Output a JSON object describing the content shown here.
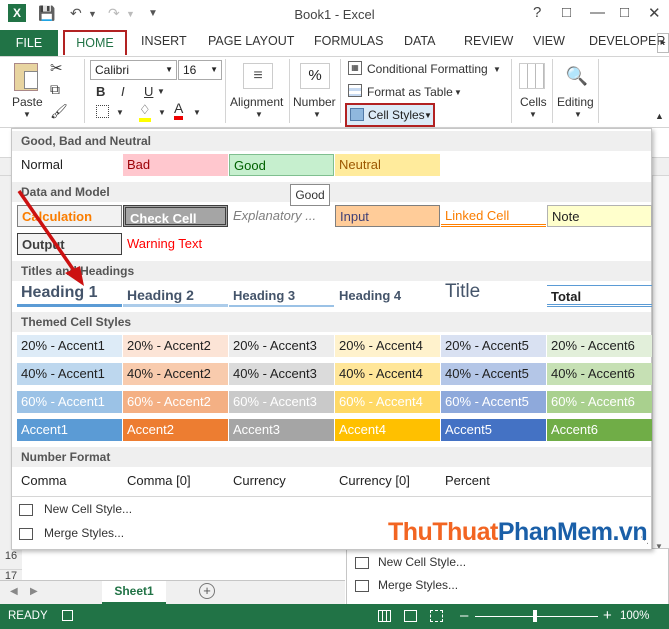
{
  "window": {
    "title": "Book1 - Excel",
    "qa_icons": [
      "excel-logo-icon",
      "save-icon",
      "undo-icon",
      "redo-icon",
      "customize-icon"
    ]
  },
  "tabs": {
    "file": "FILE",
    "home": "HOME",
    "others": [
      "INSERT",
      "PAGE LAYOUT",
      "FORMULAS",
      "DATA",
      "REVIEW",
      "VIEW",
      "DEVELOPER"
    ]
  },
  "ribbon": {
    "paste": "Paste",
    "font_name": "Calibri",
    "font_size": "16",
    "bold": "B",
    "italic": "I",
    "underline": "U",
    "alignment": "Alignment",
    "number": "Number",
    "number_symbol": "%",
    "conditional_formatting": "Conditional Formatting",
    "format_as_table": "Format as Table",
    "cell_styles": "Cell Styles",
    "cells": "Cells",
    "editing": "Editing"
  },
  "gallery": {
    "sections": {
      "good_bad_neutral": "Good, Bad and Neutral",
      "data_model": "Data and Model",
      "titles_headings": "Titles and Headings",
      "themed": "Themed Cell Styles",
      "number_format": "Number Format"
    },
    "row1": [
      "Normal",
      "Bad",
      "Good",
      "Neutral"
    ],
    "row2": [
      "Calculation",
      "Check Cell",
      "Explanatory ...",
      "Input",
      "Linked Cell",
      "Note"
    ],
    "row3": [
      "Output",
      "Warning Text"
    ],
    "headings": [
      "Heading 1",
      "Heading 2",
      "Heading 3",
      "Heading 4",
      "Title",
      "Total"
    ],
    "accent20": [
      "20% - Accent1",
      "20% - Accent2",
      "20% - Accent3",
      "20% - Accent4",
      "20% - Accent5",
      "20% - Accent6"
    ],
    "accent40": [
      "40% - Accent1",
      "40% - Accent2",
      "40% - Accent3",
      "40% - Accent4",
      "40% - Accent5",
      "40% - Accent6"
    ],
    "accent60": [
      "60% - Accent1",
      "60% - Accent2",
      "60% - Accent3",
      "60% - Accent4",
      "60% - Accent5",
      "60% - Accent6"
    ],
    "accent100": [
      "Accent1",
      "Accent2",
      "Accent3",
      "Accent4",
      "Accent5",
      "Accent6"
    ],
    "number_formats": [
      "Comma",
      "Comma [0]",
      "Currency",
      "Currency [0]",
      "Percent"
    ],
    "menu": [
      "New Cell Style...",
      "Merge Styles..."
    ]
  },
  "tooltip": "Good",
  "back_menu": [
    "New Cell Style...",
    "Merge Styles..."
  ],
  "sheet": {
    "row_numbers": [
      "16",
      "17"
    ],
    "tab": "Sheet1"
  },
  "status": {
    "ready": "READY",
    "zoom": "100%"
  },
  "watermark": {
    "part1": "Thu",
    "part2": "Thuat",
    "part3": "PhanMem",
    "part4": ".vn"
  },
  "colors": {
    "excel_green": "#217346",
    "highlight_red": "#b22222",
    "accent1": "#5b9bd5",
    "accent2": "#ed7d31",
    "accent3": "#a5a5a5",
    "accent4": "#ffc000",
    "accent5": "#4472c4",
    "accent6": "#70ad47"
  }
}
